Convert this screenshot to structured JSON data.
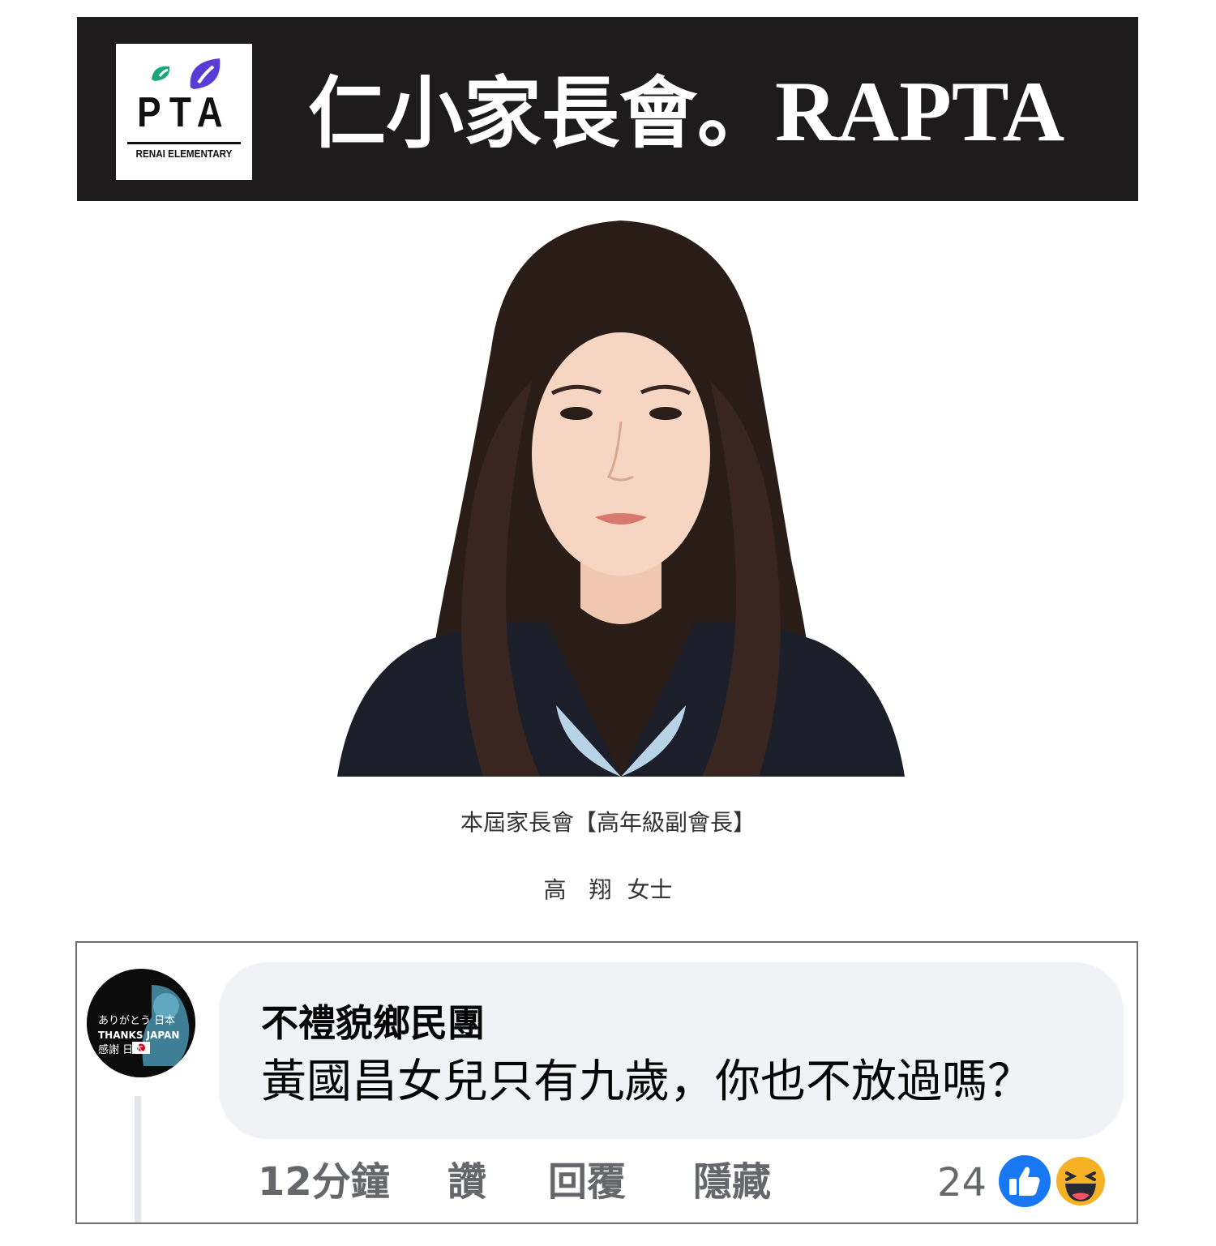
{
  "banner": {
    "logo": {
      "letters": "PTA",
      "subtitle": "RENAI ELEMENTARY"
    },
    "title_cjk": "仁小家長會",
    "title_dot": "。",
    "title_latin": "RAPTA"
  },
  "profile": {
    "role": "本屆家長會【高年級副會長】",
    "name": "高　翔 女士"
  },
  "comment": {
    "avatar_text": {
      "line1": "ありがとう 日本",
      "line2": "THANKS JAPAN",
      "line3": "感謝 日本"
    },
    "author": "不禮貌鄉民團",
    "text": "黃國昌女兒只有九歲，你也不放過嗎？",
    "time": "12分鐘",
    "like_label": "讚",
    "reply_label": "回覆",
    "hide_label": "隱藏",
    "reaction_count": "24",
    "reactions": [
      "like-icon",
      "haha-icon"
    ]
  },
  "colors": {
    "banner_bg": "#1d1b1b",
    "bubble_bg": "#f0f2f5",
    "action_text": "#65676b",
    "like_blue": "#1877f2",
    "haha_yellow": "#f7b125",
    "logo_green": "#1aa67a",
    "logo_purple": "#5b3bd6"
  }
}
